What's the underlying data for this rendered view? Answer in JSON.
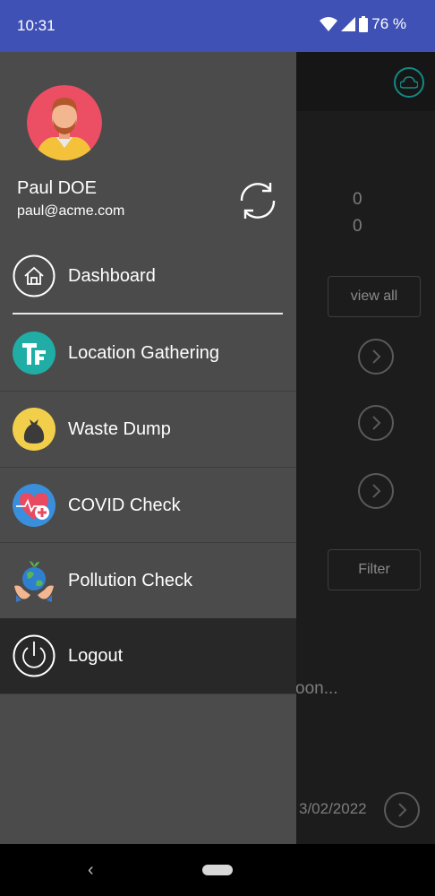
{
  "status_bar": {
    "time": "10:31",
    "battery_percent": "76 %",
    "icons": [
      "wifi-icon",
      "signal-icon",
      "battery-icon"
    ]
  },
  "background_screen": {
    "values": [
      "0",
      "0"
    ],
    "view_all_label": "view all",
    "filter_label": "Filter",
    "partial_text": "oon...",
    "date_text": "3/02/2022",
    "icons": [
      "cloud-icon",
      "chevron-right-icon"
    ]
  },
  "drawer": {
    "user": {
      "name": "Paul DOE",
      "email": "paul@acme.com"
    },
    "sync_icon": "sync-icon",
    "items": [
      {
        "label": "Dashboard",
        "icon": "home-icon"
      },
      {
        "label": "Location Gathering",
        "icon": "tf-logo-icon"
      },
      {
        "label": "Waste Dump",
        "icon": "trash-bag-icon"
      },
      {
        "label": "COVID Check",
        "icon": "heart-health-icon"
      },
      {
        "label": "Pollution Check",
        "icon": "earth-hands-icon"
      },
      {
        "label": "Logout",
        "icon": "power-icon"
      }
    ]
  },
  "colors": {
    "status_bar": "#3f51b5",
    "drawer_bg": "#4b4b4b",
    "logout_bg": "#282828",
    "accent_teal": "#128a86"
  }
}
